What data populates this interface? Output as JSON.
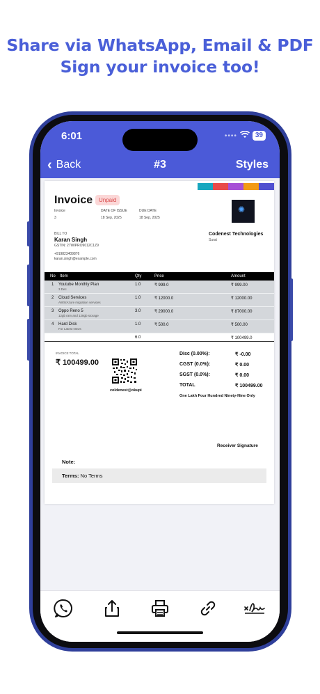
{
  "promo": {
    "line1": "Share via WhatsApp, Email & PDF",
    "line2": "Sign your invoice too!"
  },
  "status": {
    "time": "6:01",
    "battery": "39"
  },
  "nav": {
    "back_label": "Back",
    "title": "#3",
    "styles_label": "Styles"
  },
  "colors": {
    "accent": "#4b5ad8",
    "swatches": [
      "#18a7bf",
      "#e84a4a",
      "#a64fd6",
      "#f29a15",
      "#5050d0"
    ]
  },
  "invoice": {
    "heading": "Invoice",
    "status_badge": "Unpaid",
    "meta": [
      {
        "label": "Invoice",
        "value": "3"
      },
      {
        "label": "DATE OF ISSUE",
        "value": "18 Sep, 2025"
      },
      {
        "label": "DUE DATE",
        "value": "18 Sep, 2025"
      }
    ],
    "bill_to": {
      "label": "BILL TO",
      "name": "Karan Singh",
      "gstin": "GSTIN: 27WIPRO9012C1Z9",
      "phone": "+919823409876",
      "email": "karan.singh@example.com"
    },
    "company": {
      "name": "Codenest Technologies",
      "city": "Surat"
    },
    "table": {
      "headers": {
        "no": "No",
        "item": "Item",
        "qty": "Qty",
        "price": "Price",
        "amount": "Amount"
      },
      "rows": [
        {
          "no": "1",
          "item": "Youtube Monthly Plan",
          "desc": "3 Dec",
          "qty": "1.0",
          "price": "₹ 999.0",
          "amount": "₹ 999.00"
        },
        {
          "no": "2",
          "item": "Cloud Services",
          "desc": "AWS/Azure migration services",
          "qty": "1.0",
          "price": "₹ 12000.0",
          "amount": "₹ 12000.00"
        },
        {
          "no": "3",
          "item": "Oppo Reno 5",
          "desc": "12gb ram and 128gb storage",
          "qty": "3.0",
          "price": "₹ 29000.0",
          "amount": "₹ 87000.00"
        },
        {
          "no": "4",
          "item": "Hard Disk",
          "desc": "For Latest News",
          "qty": "1.0",
          "price": "₹ 500.0",
          "amount": "₹ 500.00"
        }
      ],
      "total_qty": "6.0",
      "total_amount": "₹ 100499.0"
    },
    "invoice_total_label": "INVOICE TOTAL",
    "invoice_total": "₹ 100499.00",
    "upi_id": "coldenest@okupi",
    "summary": [
      {
        "label": "Disc (0.00%):",
        "value": "₹ -0.00"
      },
      {
        "label": "CGST (0.0%):",
        "value": "₹ 0.00"
      },
      {
        "label": "SGST (0.0%):",
        "value": "₹ 0.00"
      },
      {
        "label": "TOTAL",
        "value": "₹ 100499.00"
      }
    ],
    "amount_in_words": "One Lakh Four Hundred Ninety-Nine Only",
    "receiver_signature": "Receiver Signature",
    "note_label": "Note:",
    "terms_label": "Terms:",
    "terms_value": "No Terms"
  },
  "toolbar": {
    "icons": [
      "whatsapp-icon",
      "share-icon",
      "print-icon",
      "link-icon",
      "signature-icon"
    ]
  }
}
